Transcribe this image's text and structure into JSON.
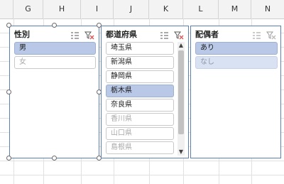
{
  "columns": [
    "G",
    "H",
    "I",
    "J",
    "K",
    "L",
    "M",
    "N"
  ],
  "slicers": {
    "gender": {
      "title": "性別",
      "items": [
        {
          "label": "男",
          "selected": true,
          "has_data": true
        },
        {
          "label": "女",
          "selected": false,
          "has_data": false
        }
      ]
    },
    "prefecture": {
      "title": "都道府県",
      "items": [
        {
          "label": "埼玉県",
          "selected": false,
          "has_data": true
        },
        {
          "label": "新潟県",
          "selected": false,
          "has_data": true
        },
        {
          "label": "静岡県",
          "selected": false,
          "has_data": true
        },
        {
          "label": "栃木県",
          "selected": true,
          "has_data": true
        },
        {
          "label": "奈良県",
          "selected": false,
          "has_data": true
        },
        {
          "label": "香川県",
          "selected": false,
          "has_data": false
        },
        {
          "label": "山口県",
          "selected": false,
          "has_data": false
        },
        {
          "label": "島根県",
          "selected": false,
          "has_data": false
        }
      ]
    },
    "spouse": {
      "title": "配偶者",
      "items": [
        {
          "label": "あり",
          "selected": true,
          "has_data": true
        },
        {
          "label": "なし",
          "selected": true,
          "has_data": false
        }
      ]
    }
  },
  "icons": {
    "multi_select": "multi-select-icon",
    "clear_filter": "clear-filter-icon"
  },
  "colors": {
    "selected_item": "#b8c8e6",
    "slicer_border": "#5b7fb5",
    "clear_filter_x": "#d9534f"
  }
}
